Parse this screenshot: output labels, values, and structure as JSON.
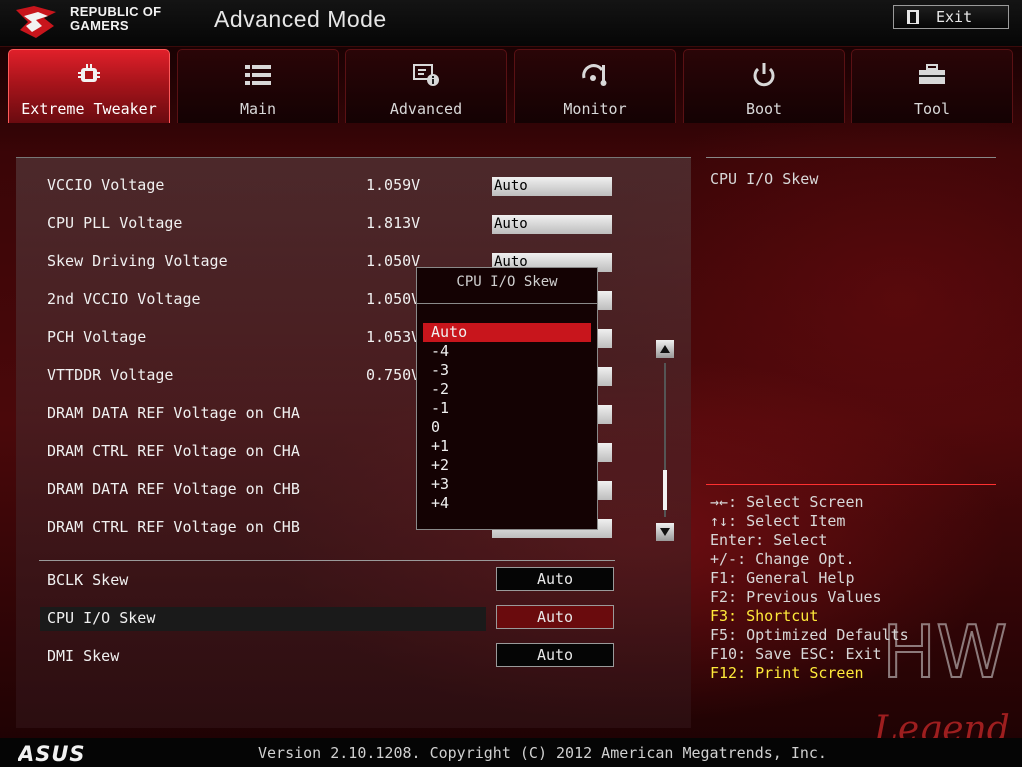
{
  "header": {
    "brand_line1": "REPUBLIC OF",
    "brand_line2": "GAMERS",
    "mode_title": "Advanced Mode",
    "exit_label": "Exit"
  },
  "tabs": [
    {
      "label": "Extreme Tweaker",
      "icon": "tweaker-icon",
      "active": true
    },
    {
      "label": "Main",
      "icon": "list-icon"
    },
    {
      "label": "Advanced",
      "icon": "advanced-info-icon"
    },
    {
      "label": "Monitor",
      "icon": "monitor-gauge-icon"
    },
    {
      "label": "Boot",
      "icon": "power-icon"
    },
    {
      "label": "Tool",
      "icon": "toolbox-icon"
    }
  ],
  "voltages": [
    {
      "label": "VCCIO Voltage",
      "value": "1.059V",
      "setting": "Auto"
    },
    {
      "label": "CPU PLL Voltage",
      "value": "1.813V",
      "setting": "Auto"
    },
    {
      "label": "Skew Driving Voltage",
      "value": "1.050V",
      "setting": "Auto"
    },
    {
      "label": "2nd VCCIO Voltage",
      "value": "1.050V",
      "setting": ""
    },
    {
      "label": "PCH Voltage",
      "value": "1.053V",
      "setting": ""
    },
    {
      "label": "VTTDDR Voltage",
      "value": "0.750V",
      "setting": ""
    },
    {
      "label": "DRAM DATA REF Voltage on CHA",
      "value": "",
      "setting": ""
    },
    {
      "label": "DRAM CTRL REF Voltage on CHA",
      "value": "",
      "setting": ""
    },
    {
      "label": "DRAM DATA REF Voltage on CHB",
      "value": "",
      "setting": ""
    },
    {
      "label": "DRAM CTRL REF Voltage on CHB",
      "value": "",
      "setting": ""
    }
  ],
  "skews": [
    {
      "label": "BCLK Skew",
      "setting": "Auto"
    },
    {
      "label": "CPU I/O Skew",
      "setting": "Auto",
      "selected": true
    },
    {
      "label": "DMI Skew",
      "setting": "Auto"
    }
  ],
  "popup": {
    "title": "CPU I/O Skew",
    "options": [
      "Auto",
      "-4",
      "-3",
      "-2",
      "-1",
      "0",
      "+1",
      "+2",
      "+3",
      "+4"
    ],
    "selected_index": 0
  },
  "help": {
    "title": "CPU I/O Skew",
    "keys": [
      {
        "text": "→←: Select Screen"
      },
      {
        "text": "↑↓: Select Item"
      },
      {
        "text": "Enter: Select"
      },
      {
        "text": "+/-: Change Opt."
      },
      {
        "text": "F1: General Help"
      },
      {
        "text": "F2: Previous Values"
      },
      {
        "text": "F3: Shortcut",
        "highlight": true
      },
      {
        "text": "F5: Optimized Defaults"
      },
      {
        "text": "F10: Save  ESC: Exit"
      },
      {
        "text": "F12: Print Screen",
        "highlight": true
      }
    ]
  },
  "watermark": {
    "line1": "HW",
    "line2": "Legend"
  },
  "footer": {
    "logo": "ASUS",
    "version": "Version 2.10.1208. Copyright (C) 2012 American Megatrends, Inc."
  },
  "colors": {
    "accent_red": "#c8151c",
    "highlight_yellow": "#ffea3a",
    "field_light": "#e0e0e0",
    "panel_bg": "#140203"
  }
}
